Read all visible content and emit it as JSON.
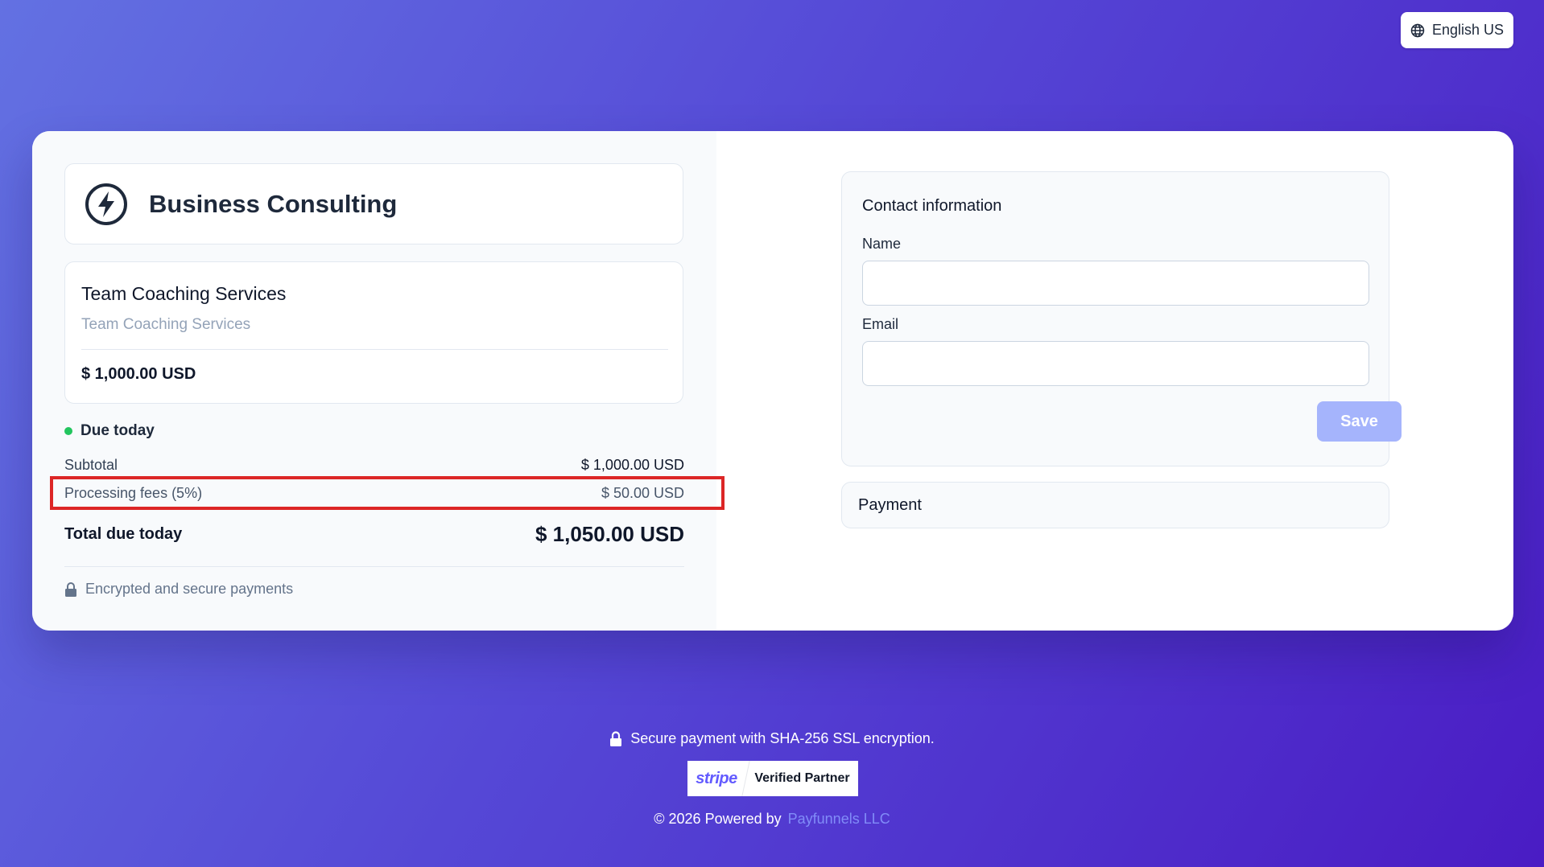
{
  "language": {
    "label": "English US",
    "icon": "globe-icon"
  },
  "merchant": {
    "name": "Business Consulting",
    "icon": "lightning-bolt-icon"
  },
  "product": {
    "title": "Team Coaching Services",
    "description": "Team Coaching Services",
    "price": "$ 1,000.00 USD"
  },
  "summary": {
    "due_label": "Due today",
    "subtotal_label": "Subtotal",
    "subtotal_value": "$ 1,000.00 USD",
    "fees_label": "Processing fees (5%)",
    "fees_value": "$ 50.00 USD",
    "total_label": "Total due today",
    "total_value": "$ 1,050.00 USD",
    "secure_note": "Encrypted and secure payments"
  },
  "contact": {
    "title": "Contact information",
    "name_label": "Name",
    "name_value": "",
    "email_label": "Email",
    "email_value": "",
    "save_label": "Save"
  },
  "payment": {
    "title": "Payment"
  },
  "footer": {
    "secure_text": "Secure payment with SHA-256 SSL encryption.",
    "stripe_logo": "stripe",
    "stripe_badge": "Verified Partner",
    "copyright": "© 2026 Powered by",
    "powered_link": "Payfunnels LLC"
  },
  "colors": {
    "accent": "#a5b4fc",
    "link": "#818cf8",
    "status_green": "#22c55e",
    "highlight": "#dc2626",
    "stripe": "#635bff"
  }
}
